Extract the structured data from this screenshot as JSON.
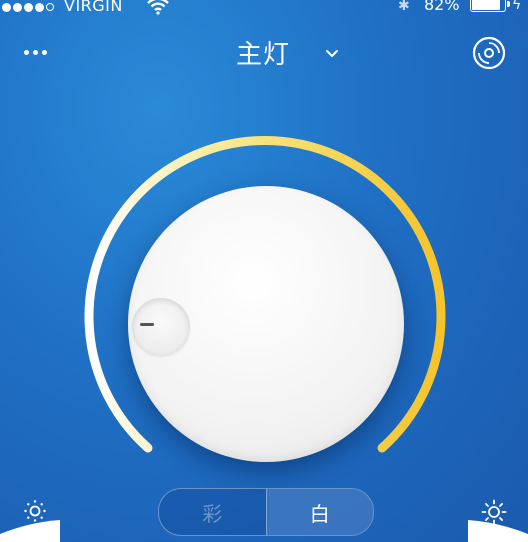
{
  "status_bar": {
    "signal_bars_filled": 4,
    "signal_bars_total": 5,
    "carrier": "VIRGIN",
    "battery_percent": "82%",
    "battery_level": 0.82
  },
  "header": {
    "title": "主灯",
    "more_icon": "more-dots-icon",
    "dropdown_icon": "chevron-down-icon",
    "right_icon": "disc-icon"
  },
  "dial": {
    "level": 0.0,
    "arc_colors": {
      "start": "#ffffff",
      "end": "#f5c32a"
    },
    "knob_color": "#f2f2f2"
  },
  "controls": {
    "left_icon": "sun-dim-icon",
    "right_icon": "sun-bright-icon",
    "mode_options": [
      "彩",
      "白"
    ],
    "selected_mode": "白"
  },
  "colors": {
    "background": "#1f6fc4",
    "accent": "#f5c32a"
  }
}
